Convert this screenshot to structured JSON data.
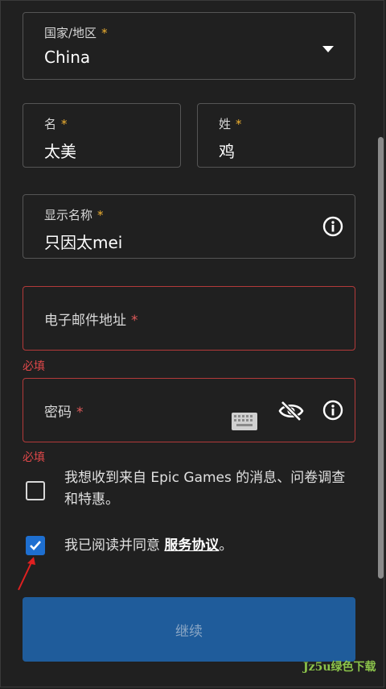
{
  "country": {
    "label": "国家/地区",
    "required_mark": "*",
    "value": "China"
  },
  "first_name": {
    "label": "名",
    "required_mark": "*",
    "value": "太美"
  },
  "last_name": {
    "label": "姓",
    "required_mark": "*",
    "value": "鸡"
  },
  "display_name": {
    "label": "显示名称",
    "required_mark": "*",
    "value": "只因太mei"
  },
  "email": {
    "label": "电子邮件地址",
    "required_mark": "*",
    "error": "必填"
  },
  "password": {
    "label": "密码",
    "required_mark": "*",
    "error": "必填"
  },
  "marketing_consent": {
    "text": "我想收到来自 Epic Games 的消息、问卷调查和特惠。",
    "checked": false
  },
  "terms": {
    "prefix": "我已阅读并同意 ",
    "link": "服务协议",
    "suffix": "。",
    "checked": true
  },
  "continue_label": "继续",
  "watermark": "Jz5u绿色下载",
  "colors": {
    "accent": "#1e6fd0",
    "error": "#e0484a",
    "required": "#f0b130",
    "button": "#1f5c9b"
  }
}
